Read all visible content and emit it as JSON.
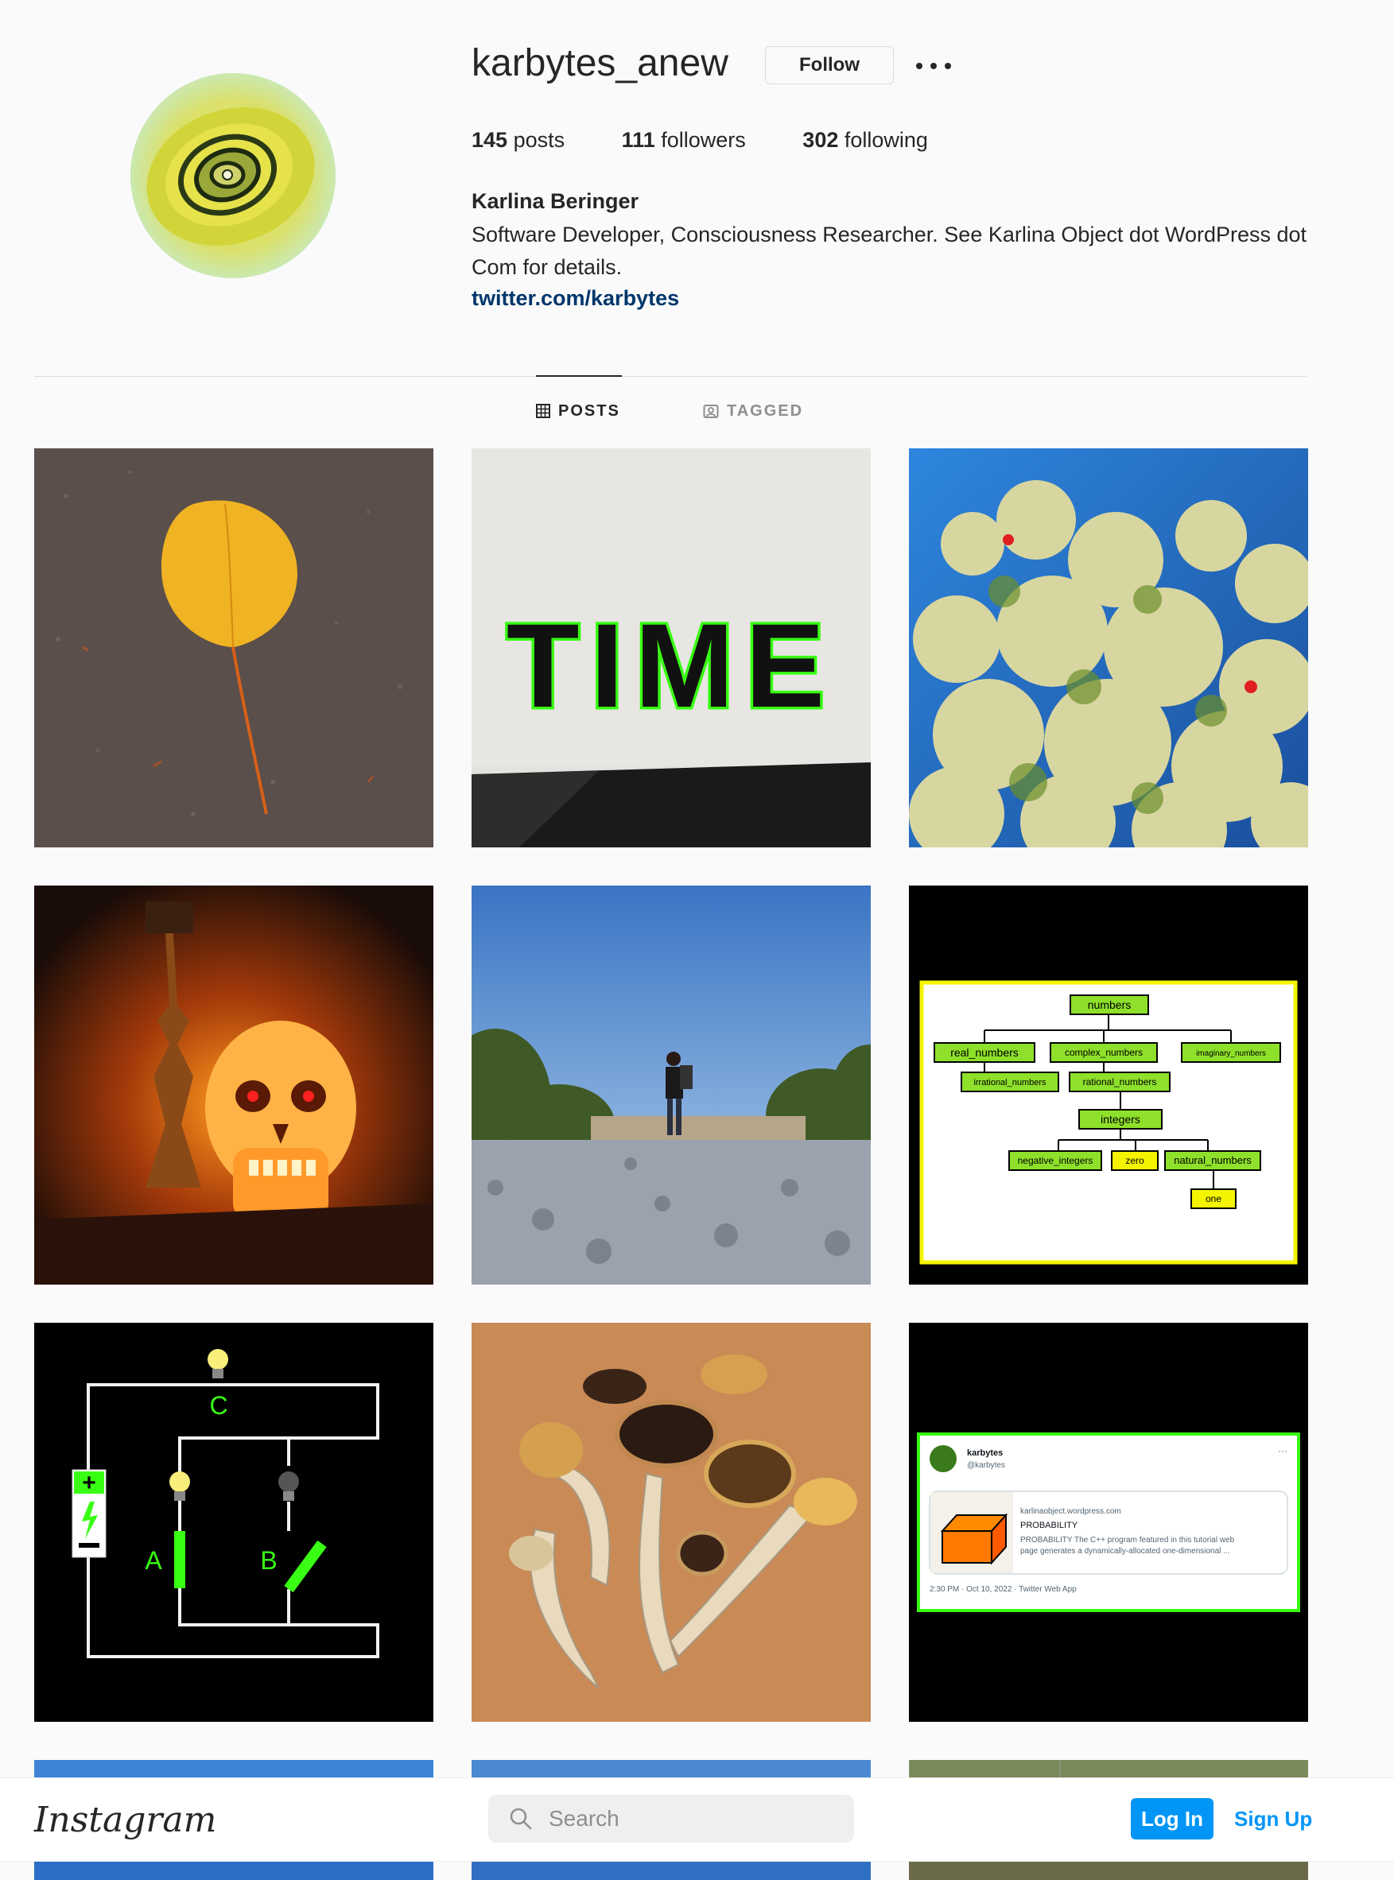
{
  "profile": {
    "username": "karbytes_anew",
    "follow_label": "Follow",
    "more_label": "•••",
    "stats": {
      "posts_count": "145",
      "posts_label": "posts",
      "followers_count": "111",
      "followers_label": "followers",
      "following_count": "302",
      "following_label": "following"
    },
    "full_name": "Karlina Beringer",
    "bio": "Software Developer, Consciousness Researcher. See Karlina Object dot WordPress dot Com for details.",
    "link": "twitter.com/karbytes"
  },
  "tabs": [
    {
      "label": "POSTS",
      "icon": "grid-icon",
      "active": true
    },
    {
      "label": "TAGGED",
      "icon": "tagged-icon",
      "active": false
    }
  ],
  "posts": [
    {
      "subject": "yellow leaf on pavement"
    },
    {
      "subject": "TIME"
    },
    {
      "subject": "flowering shrub against blue sky"
    },
    {
      "subject": "glowing skull lamp"
    },
    {
      "subject": "hiker standing on gravel"
    },
    {
      "subject": "numbers diagram",
      "diagram_labels": [
        "numbers",
        "real_numbers",
        "complex_numbers",
        "imaginary_numbers",
        "irrational_numbers",
        "rational_numbers",
        "integers",
        "negative_integers",
        "zero",
        "natural_numbers",
        "one"
      ]
    },
    {
      "subject": "light bulb circuit",
      "labels": [
        "C",
        "A",
        "B"
      ]
    },
    {
      "subject": "dried mushrooms"
    },
    {
      "subject": "tweet screenshot",
      "tweet": {
        "name": "karbytes",
        "handle": "@karbytes",
        "link_domain": "karlinaobject.wordpress.com",
        "link_title": "PROBABILITY",
        "link_desc_1": "PROBABILITY The C++ program featured in this tutorial web",
        "link_desc_2": "page generates a dynamically-allocated one-dimensional ...",
        "meta": "2:30 PM · Oct 10, 2022 · Twitter Web App",
        "more": "···"
      }
    }
  ],
  "bottom_bar": {
    "logo": "Instagram",
    "search_placeholder": "Search",
    "login_label": "Log In",
    "signup_label": "Sign Up"
  },
  "colors": {
    "accent": "#0095f6",
    "link": "#00376b",
    "text": "#262626",
    "muted": "#8e8e8e",
    "background": "#fafafa"
  }
}
